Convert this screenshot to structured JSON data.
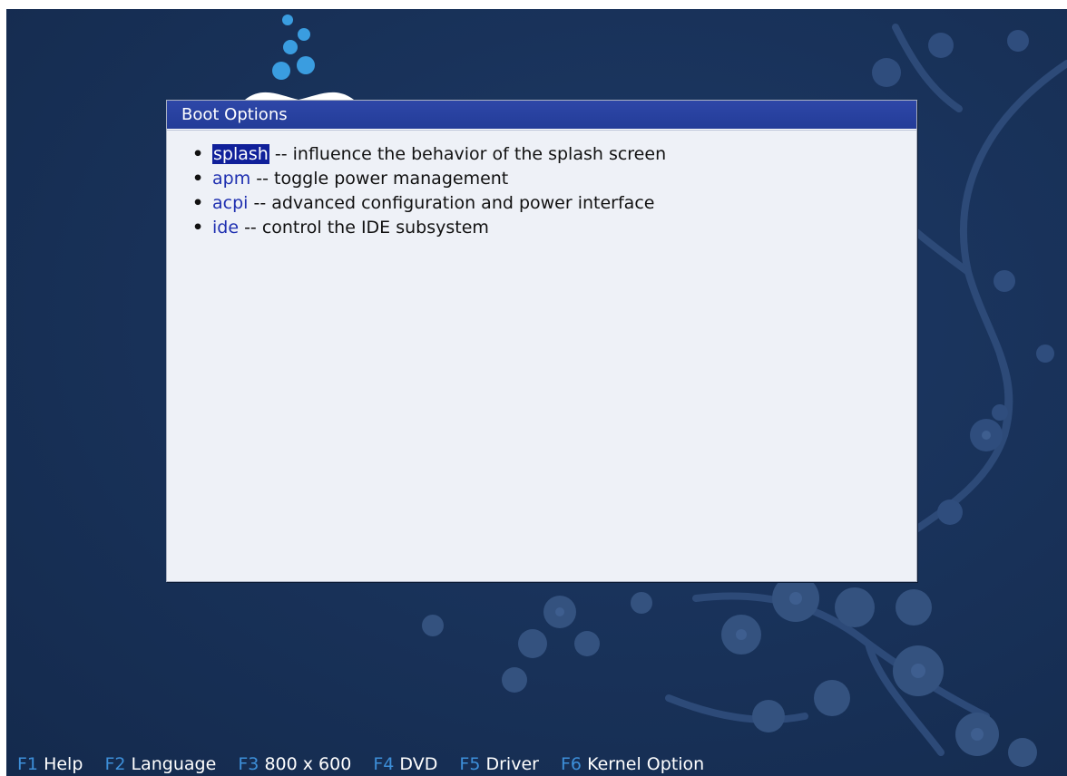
{
  "dialog": {
    "title": "Boot Options",
    "options": [
      {
        "key": "splash",
        "description": " -- influence the behavior of the splash screen"
      },
      {
        "key": "apm",
        "description": " -- toggle power management"
      },
      {
        "key": "acpi",
        "description": " -- advanced configuration and power interface"
      },
      {
        "key": "ide",
        "description": " -- control the IDE subsystem"
      }
    ]
  },
  "footer": {
    "items": [
      {
        "key": "F1",
        "label": "Help"
      },
      {
        "key": "F2",
        "label": "Language"
      },
      {
        "key": "F3",
        "label": "800 x 600"
      },
      {
        "key": "F4",
        "label": "DVD"
      },
      {
        "key": "F5",
        "label": "Driver"
      },
      {
        "key": "F6",
        "label": "Kernel Option"
      }
    ]
  },
  "colors": {
    "background": "#183158",
    "title_bar": "#233c98",
    "dialog_body": "#eef1f7",
    "option_key": "#1e2fb0",
    "selection": "#10209a",
    "fkey": "#3d8fd9",
    "logo": "#3a9de0"
  }
}
